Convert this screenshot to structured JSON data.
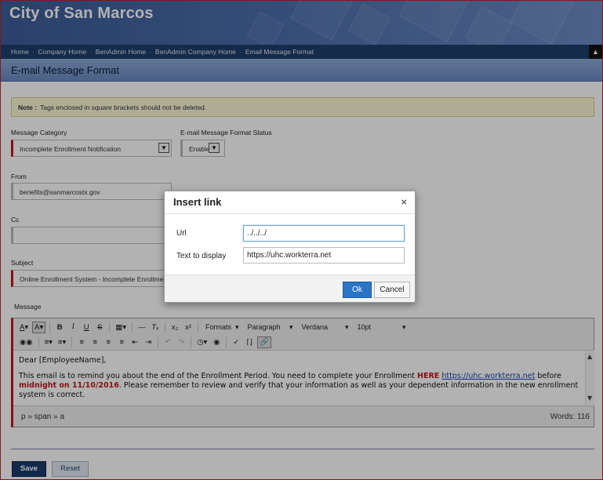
{
  "banner": {
    "title": "City of San Marcos"
  },
  "breadcrumb": [
    "Home",
    "Company Home",
    "BenAdmin Home",
    "BenAdmin Company Home",
    "Email Message Format"
  ],
  "page": {
    "title": "E-mail Message Format"
  },
  "note": {
    "label": "Note :",
    "text": "Tags enclosed in square brackets should not be deleted."
  },
  "form": {
    "category_label": "Message Category",
    "category_value": "Incomplete Enrollment Notification",
    "status_label": "E-mail Message Format Status",
    "status_value": "Enable",
    "from_label": "From",
    "from_value": "benefits@sanmarcostx.gov",
    "cc_label": "Cc",
    "cc_value": "",
    "subject_label": "Subject",
    "subject_value": "Online Enrollment System - Incomplete Enrollment Notification",
    "message_label": "Message"
  },
  "editor": {
    "formats": "Formats",
    "paragraph": "Paragraph",
    "font": "Verdana",
    "size": "10pt",
    "greeting": "Dear [EmployeeName],",
    "body_1": "This email is to remind you about the end of the Enrollment Period. You need to complete your Enrollment ",
    "here": "HERE",
    "link": "https://uhc.workterra.net",
    "body_2": " before ",
    "deadline": "midnight on 11/10/2016",
    "body_3": ". Please remember to review and verify that your information as well as your dependent information in the new enrollment system is correct.",
    "path": "p » span » a",
    "words": "Words: 116"
  },
  "actions": {
    "save": "Save",
    "reset": "Reset"
  },
  "dialog": {
    "title": "Insert link",
    "close": "×",
    "url_label": "Url",
    "url_value": "../../../",
    "text_label": "Text to display",
    "text_value": "https://uhc.workterra.net",
    "ok": "Ok",
    "cancel": "Cancel"
  }
}
